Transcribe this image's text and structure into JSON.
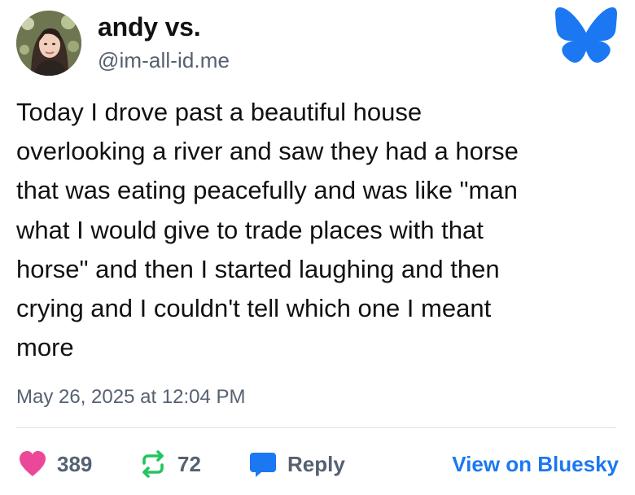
{
  "author": {
    "name": "andy vs.",
    "handle": "@im-all-id.me",
    "avatar_icon": "profile-photo"
  },
  "post": {
    "text": "Today I drove past a beautiful house\noverlooking a river and saw they had a horse\nthat was eating peacefully and was like \"man\nwhat I would give to trade places with that\nhorse\" and then I started laughing and then\ncrying and I couldn't tell which one I meant\nmore",
    "timestamp": "May 26, 2025 at 12:04 PM"
  },
  "actions": {
    "like_count": "389",
    "repost_count": "72",
    "reply_label": "Reply",
    "view_link_label": "View on Bluesky"
  },
  "icons": {
    "bluesky": "bluesky-butterfly-icon",
    "like": "heart-icon",
    "repost": "repost-icon",
    "reply": "speech-bubble-icon"
  },
  "colors": {
    "bluesky_blue": "#1b78f2",
    "heart_pink": "#ec4899",
    "repost_green": "#22c55e",
    "reply_blue": "#1b78f2",
    "muted_text": "#556171"
  }
}
